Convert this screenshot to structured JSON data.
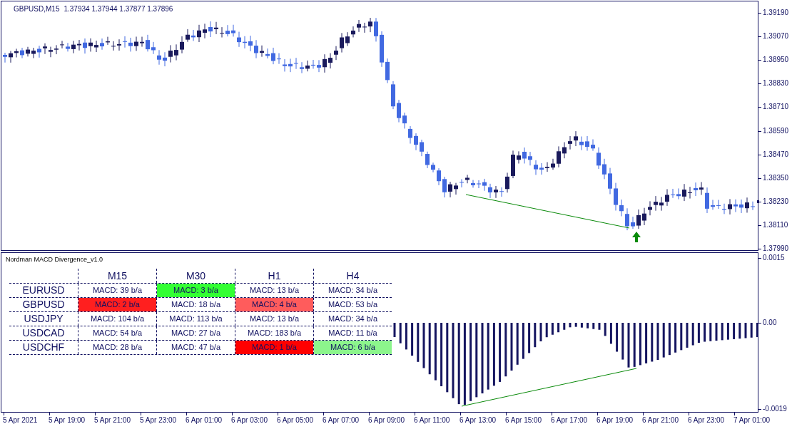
{
  "chart": {
    "symbol": "GBPUSD,M15",
    "quotes": "1.37934 1.37944 1.37877 1.37896"
  },
  "price_axis": [
    "1.39190",
    "1.39070",
    "1.38950",
    "1.38830",
    "1.38710",
    "1.38590",
    "1.38470",
    "1.38350",
    "1.38230",
    "1.38110",
    "1.37990"
  ],
  "indicator": {
    "name": "Nordman MACD Divergence_v1.0",
    "axis": [
      "0.0015",
      "0.00",
      "-0.0019"
    ],
    "table": {
      "columns": [
        "M15",
        "M30",
        "H1",
        "H4"
      ],
      "rows": [
        {
          "symbol": "EURUSD",
          "cells": [
            {
              "text": "MACD: 39 b/a"
            },
            {
              "text": "MACD: 3 b/a",
              "color": "#33ff33"
            },
            {
              "text": "MACD: 13 b/a"
            },
            {
              "text": "MACD: 34 b/a"
            }
          ]
        },
        {
          "symbol": "GBPUSD",
          "cells": [
            {
              "text": "MACD: 2 b/a",
              "color": "#ff1f1f"
            },
            {
              "text": "MACD: 18 b/a"
            },
            {
              "text": "MACD: 4 b/a",
              "color": "#ff5c5c"
            },
            {
              "text": "MACD: 53 b/a"
            }
          ]
        },
        {
          "symbol": "USDJPY",
          "cells": [
            {
              "text": "MACD: 104 b/a"
            },
            {
              "text": "MACD: 113 b/a"
            },
            {
              "text": "MACD: 13 b/a"
            },
            {
              "text": "MACD: 34 b/a"
            }
          ]
        },
        {
          "symbol": "USDCAD",
          "cells": [
            {
              "text": "MACD: 54 b/a"
            },
            {
              "text": "MACD: 27 b/a"
            },
            {
              "text": "MACD: 183 b/a"
            },
            {
              "text": "MACD: 11 b/a"
            }
          ]
        },
        {
          "symbol": "USDCHF",
          "cells": [
            {
              "text": "MACD: 28 b/a"
            },
            {
              "text": "MACD: 47 b/a"
            },
            {
              "text": "MACD: 1 b/a",
              "color": "#ff0000"
            },
            {
              "text": "MACD: 6 b/a",
              "color": "#8cf58c"
            }
          ]
        }
      ]
    }
  },
  "time_axis": [
    "5 Apr 2021",
    "5 Apr 19:00",
    "5 Apr 21:00",
    "5 Apr 23:00",
    "6 Apr 01:00",
    "6 Apr 03:00",
    "6 Apr 05:00",
    "6 Apr 07:00",
    "6 Apr 09:00",
    "6 Apr 11:00",
    "6 Apr 13:00",
    "6 Apr 15:00",
    "6 Apr 17:00",
    "6 Apr 19:00",
    "6 Apr 21:00",
    "6 Apr 23:00",
    "7 Apr 01:00"
  ]
}
